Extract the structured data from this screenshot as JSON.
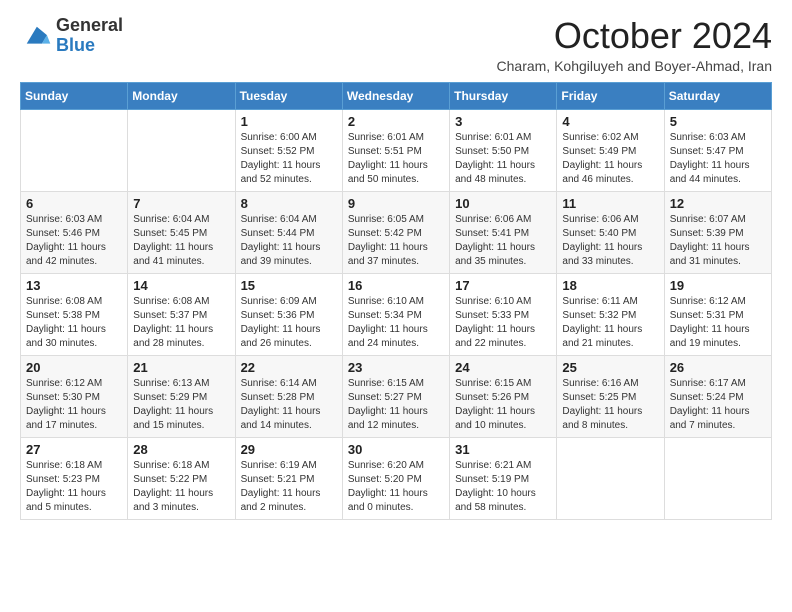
{
  "logo": {
    "general": "General",
    "blue": "Blue"
  },
  "title": "October 2024",
  "subtitle": "Charam, Kohgiluyeh and Boyer-Ahmad, Iran",
  "days_of_week": [
    "Sunday",
    "Monday",
    "Tuesday",
    "Wednesday",
    "Thursday",
    "Friday",
    "Saturday"
  ],
  "weeks": [
    [
      null,
      null,
      {
        "day": "1",
        "sunrise": "Sunrise: 6:00 AM",
        "sunset": "Sunset: 5:52 PM",
        "daylight": "Daylight: 11 hours and 52 minutes."
      },
      {
        "day": "2",
        "sunrise": "Sunrise: 6:01 AM",
        "sunset": "Sunset: 5:51 PM",
        "daylight": "Daylight: 11 hours and 50 minutes."
      },
      {
        "day": "3",
        "sunrise": "Sunrise: 6:01 AM",
        "sunset": "Sunset: 5:50 PM",
        "daylight": "Daylight: 11 hours and 48 minutes."
      },
      {
        "day": "4",
        "sunrise": "Sunrise: 6:02 AM",
        "sunset": "Sunset: 5:49 PM",
        "daylight": "Daylight: 11 hours and 46 minutes."
      },
      {
        "day": "5",
        "sunrise": "Sunrise: 6:03 AM",
        "sunset": "Sunset: 5:47 PM",
        "daylight": "Daylight: 11 hours and 44 minutes."
      }
    ],
    [
      {
        "day": "6",
        "sunrise": "Sunrise: 6:03 AM",
        "sunset": "Sunset: 5:46 PM",
        "daylight": "Daylight: 11 hours and 42 minutes."
      },
      {
        "day": "7",
        "sunrise": "Sunrise: 6:04 AM",
        "sunset": "Sunset: 5:45 PM",
        "daylight": "Daylight: 11 hours and 41 minutes."
      },
      {
        "day": "8",
        "sunrise": "Sunrise: 6:04 AM",
        "sunset": "Sunset: 5:44 PM",
        "daylight": "Daylight: 11 hours and 39 minutes."
      },
      {
        "day": "9",
        "sunrise": "Sunrise: 6:05 AM",
        "sunset": "Sunset: 5:42 PM",
        "daylight": "Daylight: 11 hours and 37 minutes."
      },
      {
        "day": "10",
        "sunrise": "Sunrise: 6:06 AM",
        "sunset": "Sunset: 5:41 PM",
        "daylight": "Daylight: 11 hours and 35 minutes."
      },
      {
        "day": "11",
        "sunrise": "Sunrise: 6:06 AM",
        "sunset": "Sunset: 5:40 PM",
        "daylight": "Daylight: 11 hours and 33 minutes."
      },
      {
        "day": "12",
        "sunrise": "Sunrise: 6:07 AM",
        "sunset": "Sunset: 5:39 PM",
        "daylight": "Daylight: 11 hours and 31 minutes."
      }
    ],
    [
      {
        "day": "13",
        "sunrise": "Sunrise: 6:08 AM",
        "sunset": "Sunset: 5:38 PM",
        "daylight": "Daylight: 11 hours and 30 minutes."
      },
      {
        "day": "14",
        "sunrise": "Sunrise: 6:08 AM",
        "sunset": "Sunset: 5:37 PM",
        "daylight": "Daylight: 11 hours and 28 minutes."
      },
      {
        "day": "15",
        "sunrise": "Sunrise: 6:09 AM",
        "sunset": "Sunset: 5:36 PM",
        "daylight": "Daylight: 11 hours and 26 minutes."
      },
      {
        "day": "16",
        "sunrise": "Sunrise: 6:10 AM",
        "sunset": "Sunset: 5:34 PM",
        "daylight": "Daylight: 11 hours and 24 minutes."
      },
      {
        "day": "17",
        "sunrise": "Sunrise: 6:10 AM",
        "sunset": "Sunset: 5:33 PM",
        "daylight": "Daylight: 11 hours and 22 minutes."
      },
      {
        "day": "18",
        "sunrise": "Sunrise: 6:11 AM",
        "sunset": "Sunset: 5:32 PM",
        "daylight": "Daylight: 11 hours and 21 minutes."
      },
      {
        "day": "19",
        "sunrise": "Sunrise: 6:12 AM",
        "sunset": "Sunset: 5:31 PM",
        "daylight": "Daylight: 11 hours and 19 minutes."
      }
    ],
    [
      {
        "day": "20",
        "sunrise": "Sunrise: 6:12 AM",
        "sunset": "Sunset: 5:30 PM",
        "daylight": "Daylight: 11 hours and 17 minutes."
      },
      {
        "day": "21",
        "sunrise": "Sunrise: 6:13 AM",
        "sunset": "Sunset: 5:29 PM",
        "daylight": "Daylight: 11 hours and 15 minutes."
      },
      {
        "day": "22",
        "sunrise": "Sunrise: 6:14 AM",
        "sunset": "Sunset: 5:28 PM",
        "daylight": "Daylight: 11 hours and 14 minutes."
      },
      {
        "day": "23",
        "sunrise": "Sunrise: 6:15 AM",
        "sunset": "Sunset: 5:27 PM",
        "daylight": "Daylight: 11 hours and 12 minutes."
      },
      {
        "day": "24",
        "sunrise": "Sunrise: 6:15 AM",
        "sunset": "Sunset: 5:26 PM",
        "daylight": "Daylight: 11 hours and 10 minutes."
      },
      {
        "day": "25",
        "sunrise": "Sunrise: 6:16 AM",
        "sunset": "Sunset: 5:25 PM",
        "daylight": "Daylight: 11 hours and 8 minutes."
      },
      {
        "day": "26",
        "sunrise": "Sunrise: 6:17 AM",
        "sunset": "Sunset: 5:24 PM",
        "daylight": "Daylight: 11 hours and 7 minutes."
      }
    ],
    [
      {
        "day": "27",
        "sunrise": "Sunrise: 6:18 AM",
        "sunset": "Sunset: 5:23 PM",
        "daylight": "Daylight: 11 hours and 5 minutes."
      },
      {
        "day": "28",
        "sunrise": "Sunrise: 6:18 AM",
        "sunset": "Sunset: 5:22 PM",
        "daylight": "Daylight: 11 hours and 3 minutes."
      },
      {
        "day": "29",
        "sunrise": "Sunrise: 6:19 AM",
        "sunset": "Sunset: 5:21 PM",
        "daylight": "Daylight: 11 hours and 2 minutes."
      },
      {
        "day": "30",
        "sunrise": "Sunrise: 6:20 AM",
        "sunset": "Sunset: 5:20 PM",
        "daylight": "Daylight: 11 hours and 0 minutes."
      },
      {
        "day": "31",
        "sunrise": "Sunrise: 6:21 AM",
        "sunset": "Sunset: 5:19 PM",
        "daylight": "Daylight: 10 hours and 58 minutes."
      },
      null,
      null
    ]
  ]
}
